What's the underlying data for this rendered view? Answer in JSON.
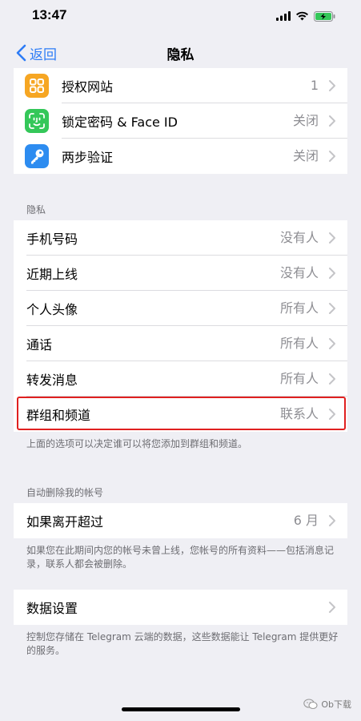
{
  "status_bar": {
    "time": "13:47"
  },
  "nav": {
    "back_label": "返回",
    "title": "隐私"
  },
  "security": {
    "items": [
      {
        "label": "授权网站",
        "value": "1",
        "icon": "grid-icon",
        "color": "#f6a623"
      },
      {
        "label": "锁定密码 & Face ID",
        "value": "关闭",
        "icon": "face-id-icon",
        "color": "#34c759"
      },
      {
        "label": "两步验证",
        "value": "关闭",
        "icon": "key-icon",
        "color": "#2d8cf0"
      }
    ]
  },
  "privacy": {
    "header": "隐私",
    "items": [
      {
        "label": "手机号码",
        "value": "没有人"
      },
      {
        "label": "近期上线",
        "value": "没有人"
      },
      {
        "label": "个人头像",
        "value": "所有人"
      },
      {
        "label": "通话",
        "value": "所有人"
      },
      {
        "label": "转发消息",
        "value": "所有人"
      },
      {
        "label": "群组和频道",
        "value": "联系人"
      }
    ],
    "footer": "上面的选项可以决定谁可以将您添加到群组和频道。"
  },
  "auto_delete": {
    "header": "自动删除我的帐号",
    "label": "如果离开超过",
    "value": "6 月",
    "footer": "如果您在此期间内您的帐号未曾上线，您帐号的所有资料——包括消息记录，联系人都会被删除。"
  },
  "data_settings": {
    "label": "数据设置",
    "footer": "控制您存储在 Telegram 云端的数据，这些数据能让 Telegram 提供更好的服务。"
  },
  "watermark": {
    "text": "Ob下载"
  },
  "colors": {
    "accent": "#2d7cf6",
    "highlight": "#e02020"
  }
}
